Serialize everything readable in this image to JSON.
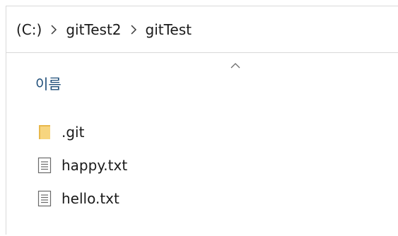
{
  "breadcrumb": {
    "items": [
      "(C:)",
      "gitTest2",
      "gitTest"
    ]
  },
  "list_header": {
    "name_column": "이름"
  },
  "files": [
    {
      "name": ".git",
      "icon": "folder-icon"
    },
    {
      "name": "happy.txt",
      "icon": "text-file-icon"
    },
    {
      "name": "hello.txt",
      "icon": "text-file-icon"
    }
  ],
  "colors": {
    "header_text": "#1f4e79",
    "folder": "#f3c96a",
    "border": "#d9d9d9"
  }
}
